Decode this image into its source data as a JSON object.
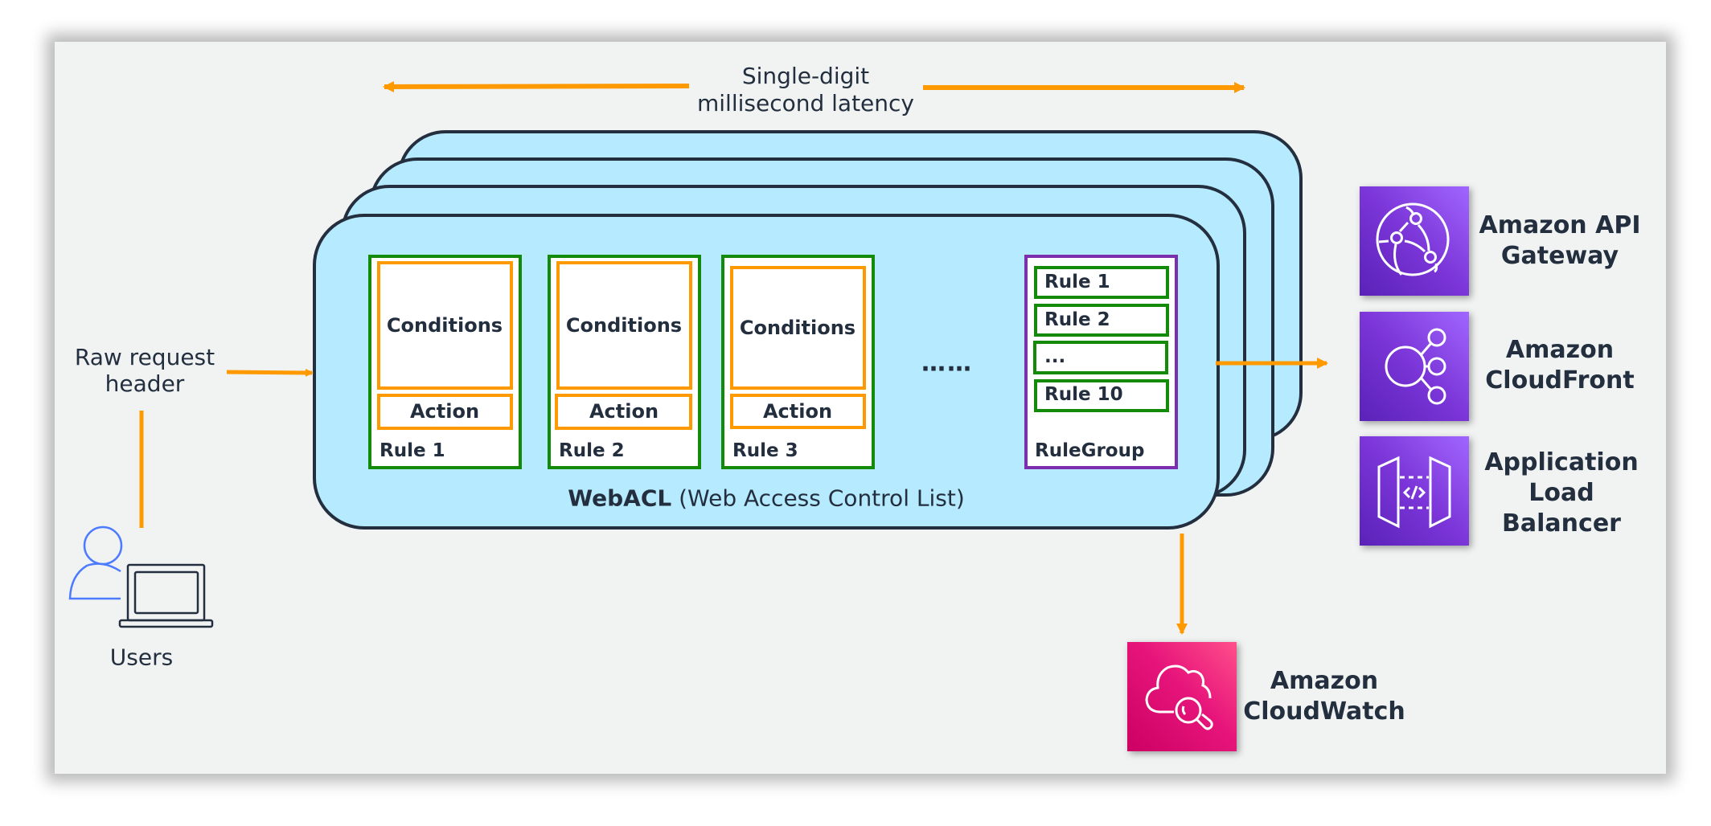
{
  "latency": {
    "line1": "Single-digit",
    "line2": "millisecond latency"
  },
  "request": {
    "line1": "Raw request",
    "line2": "header"
  },
  "users": {
    "label": "Users",
    "icon": "user-with-laptop-icon"
  },
  "webacl": {
    "bold": "WebACL",
    "rest": " (Web Access Control List)"
  },
  "rules": [
    {
      "conditions": "Conditions",
      "action": "Action",
      "name": "Rule 1"
    },
    {
      "conditions": "Conditions",
      "action": "Action",
      "name": "Rule 2"
    },
    {
      "conditions": "Conditions",
      "action": "Action",
      "name": "Rule 3"
    }
  ],
  "ellipsis": "……",
  "rulegroup": {
    "name": "RuleGroup",
    "items": [
      "Rule 1",
      "Rule 2",
      "...",
      "Rule 10"
    ]
  },
  "services": [
    {
      "line1": "Amazon API",
      "line2": "Gateway",
      "line3": "",
      "icon": "globe-network-icon"
    },
    {
      "line1": "Amazon",
      "line2": "CloudFront",
      "line3": "",
      "icon": "hub-nodes-icon"
    },
    {
      "line1": "Application",
      "line2": "Load",
      "line3": "Balancer",
      "icon": "api-gateway-code-icon"
    }
  ],
  "monitoring": {
    "line1": "Amazon",
    "line2": "CloudWatch",
    "icon": "cloud-magnifier-icon"
  },
  "colors": {
    "arrow": "#ff9900",
    "card_fill": "#b6eafe",
    "card_stroke": "#232f3e",
    "rule_border": "#138a08",
    "condition_border": "#ff9900",
    "rulegroup_border": "#7b2fae",
    "service_purple": "#8c4fff",
    "cloudwatch_pink": "#e7157b",
    "user_blue": "#4d7bff"
  }
}
